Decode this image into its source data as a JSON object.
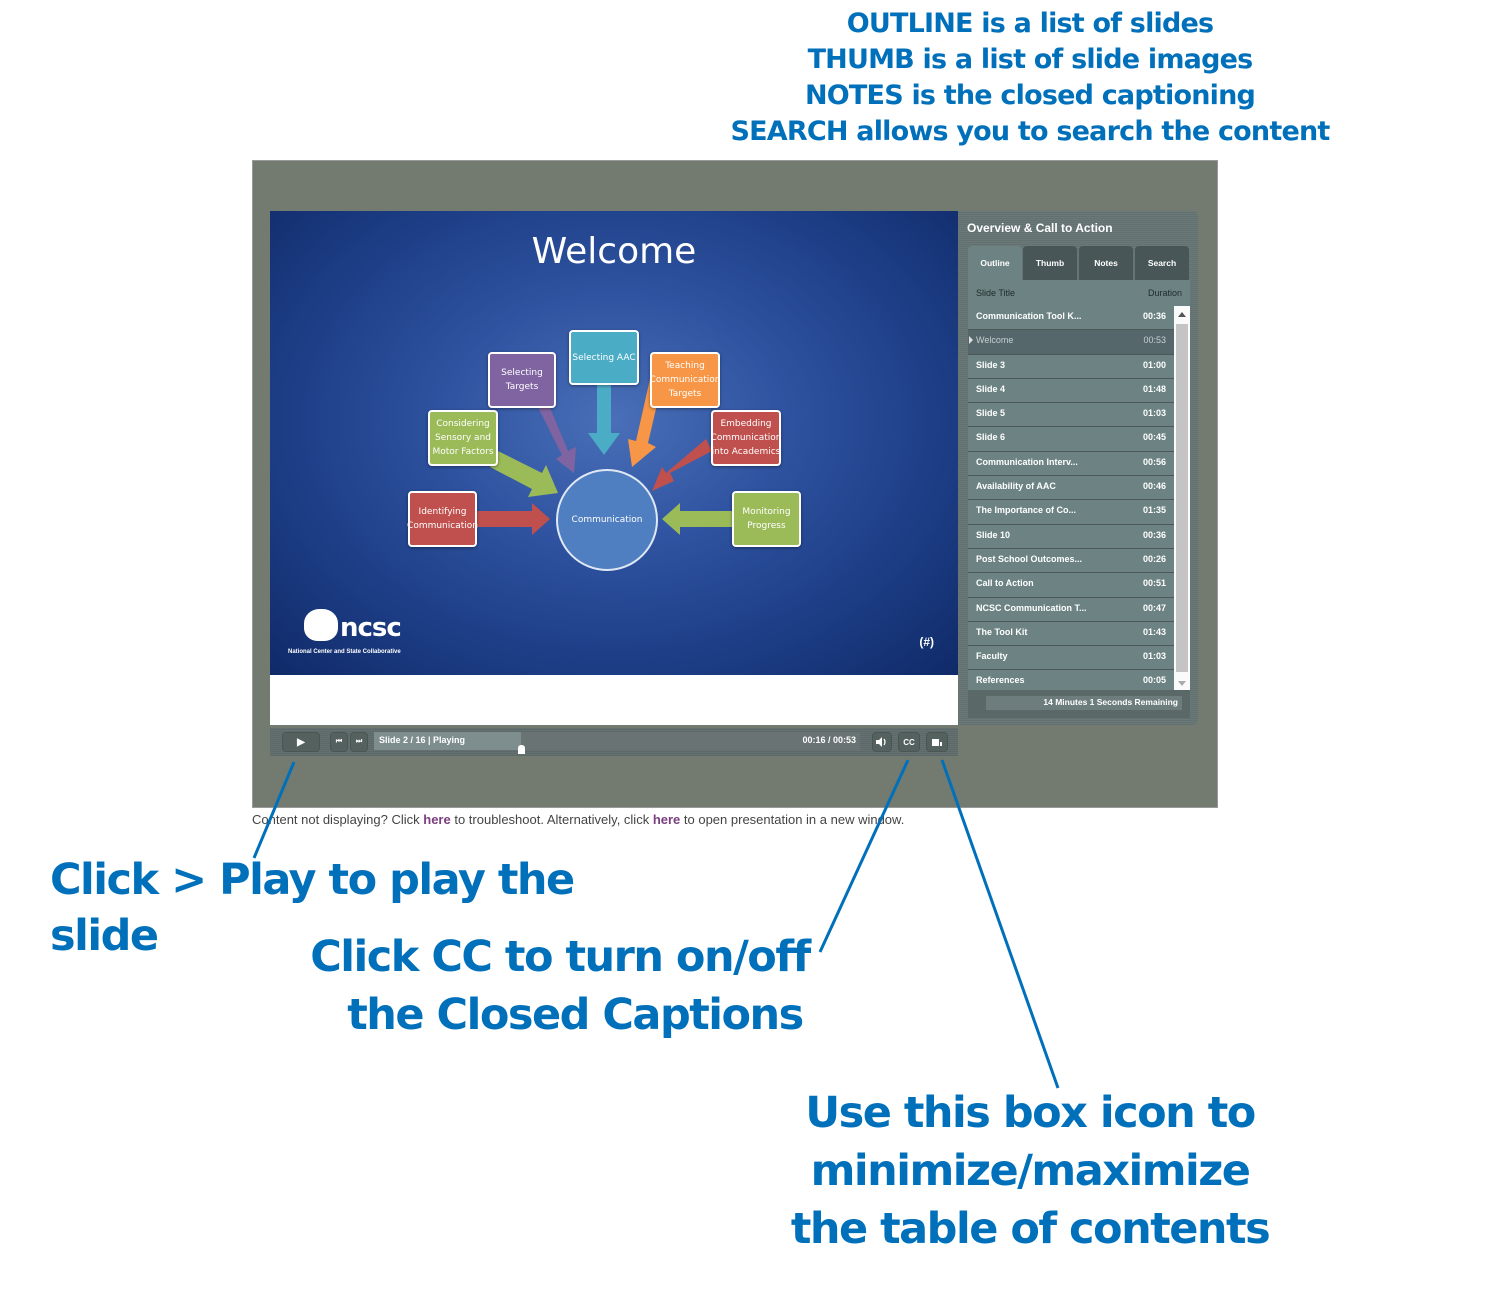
{
  "annotations": {
    "top": [
      "OUTLINE is a list of slides",
      "THUMB is a list of slide images",
      "NOTES is the closed captioning",
      "SEARCH allows you to search the content"
    ],
    "play": "Click > Play to play the slide",
    "cc": [
      "Click CC to turn on/off",
      "the Closed Captions"
    ],
    "box": [
      "Use this box icon to minimize/maximize",
      "the table of contents"
    ],
    "color": "#0070bb"
  },
  "slide": {
    "title": "Welcome",
    "center": "Communication",
    "nodes": [
      {
        "label": "Identifying Communication",
        "color": "#c0504d"
      },
      {
        "label": "Considering Sensory and Motor Factors",
        "color": "#9bbb59"
      },
      {
        "label": "Selecting Targets",
        "color": "#8064a2"
      },
      {
        "label": "Selecting AAC",
        "color": "#4bacc6"
      },
      {
        "label": "Teaching Communication Targets",
        "color": "#f79646"
      },
      {
        "label": "Embedding Communication into Academics",
        "color": "#c0504d"
      },
      {
        "label": "Monitoring Progress",
        "color": "#9bbb59"
      }
    ],
    "logo_text": "ncsc",
    "logo_subtitle": "National Center and State Collaborative",
    "page_mark": "(#)"
  },
  "player": {
    "play_icon": "▶",
    "prev_icon": "⏮",
    "next_icon": "⏭",
    "status": "Slide 2 / 16 | Playing",
    "time": "00:16 / 00:53",
    "progress_fraction": 0.302,
    "volume_icon": "volume-icon",
    "cc_label": "CC",
    "toc_toggle_icon": "box-icon"
  },
  "panel": {
    "title": "Overview & Call to Action",
    "tabs": [
      "Outline",
      "Thumb",
      "Notes",
      "Search"
    ],
    "active_tab": "Outline",
    "col_title": "Slide Title",
    "col_duration": "Duration",
    "slides": [
      {
        "title": "Communication Tool K...",
        "duration": "00:36"
      },
      {
        "title": "Welcome",
        "duration": "00:53",
        "current": true
      },
      {
        "title": "Slide 3",
        "duration": "01:00"
      },
      {
        "title": "Slide 4",
        "duration": "01:48"
      },
      {
        "title": "Slide 5",
        "duration": "01:03"
      },
      {
        "title": "Slide 6",
        "duration": "00:45"
      },
      {
        "title": "Communication Interv...",
        "duration": "00:56"
      },
      {
        "title": "Availability of AAC",
        "duration": "00:46"
      },
      {
        "title": "The Importance of Co...",
        "duration": "01:35"
      },
      {
        "title": "Slide 10",
        "duration": "00:36"
      },
      {
        "title": "Post School Outcomes...",
        "duration": "00:26"
      },
      {
        "title": "Call to Action",
        "duration": "00:51"
      },
      {
        "title": "NCSC Communication T...",
        "duration": "00:47"
      },
      {
        "title": "The Tool Kit",
        "duration": "01:43"
      },
      {
        "title": "Faculty",
        "duration": "01:03"
      },
      {
        "title": "References",
        "duration": "00:05"
      }
    ],
    "remaining": "14 Minutes 1 Seconds Remaining"
  },
  "footer": {
    "part1": "Content not displaying? Click ",
    "link1": "here",
    "part2": " to troubleshoot. Alternatively, click ",
    "link2": "here",
    "part3": " to open presentation in a new window."
  }
}
